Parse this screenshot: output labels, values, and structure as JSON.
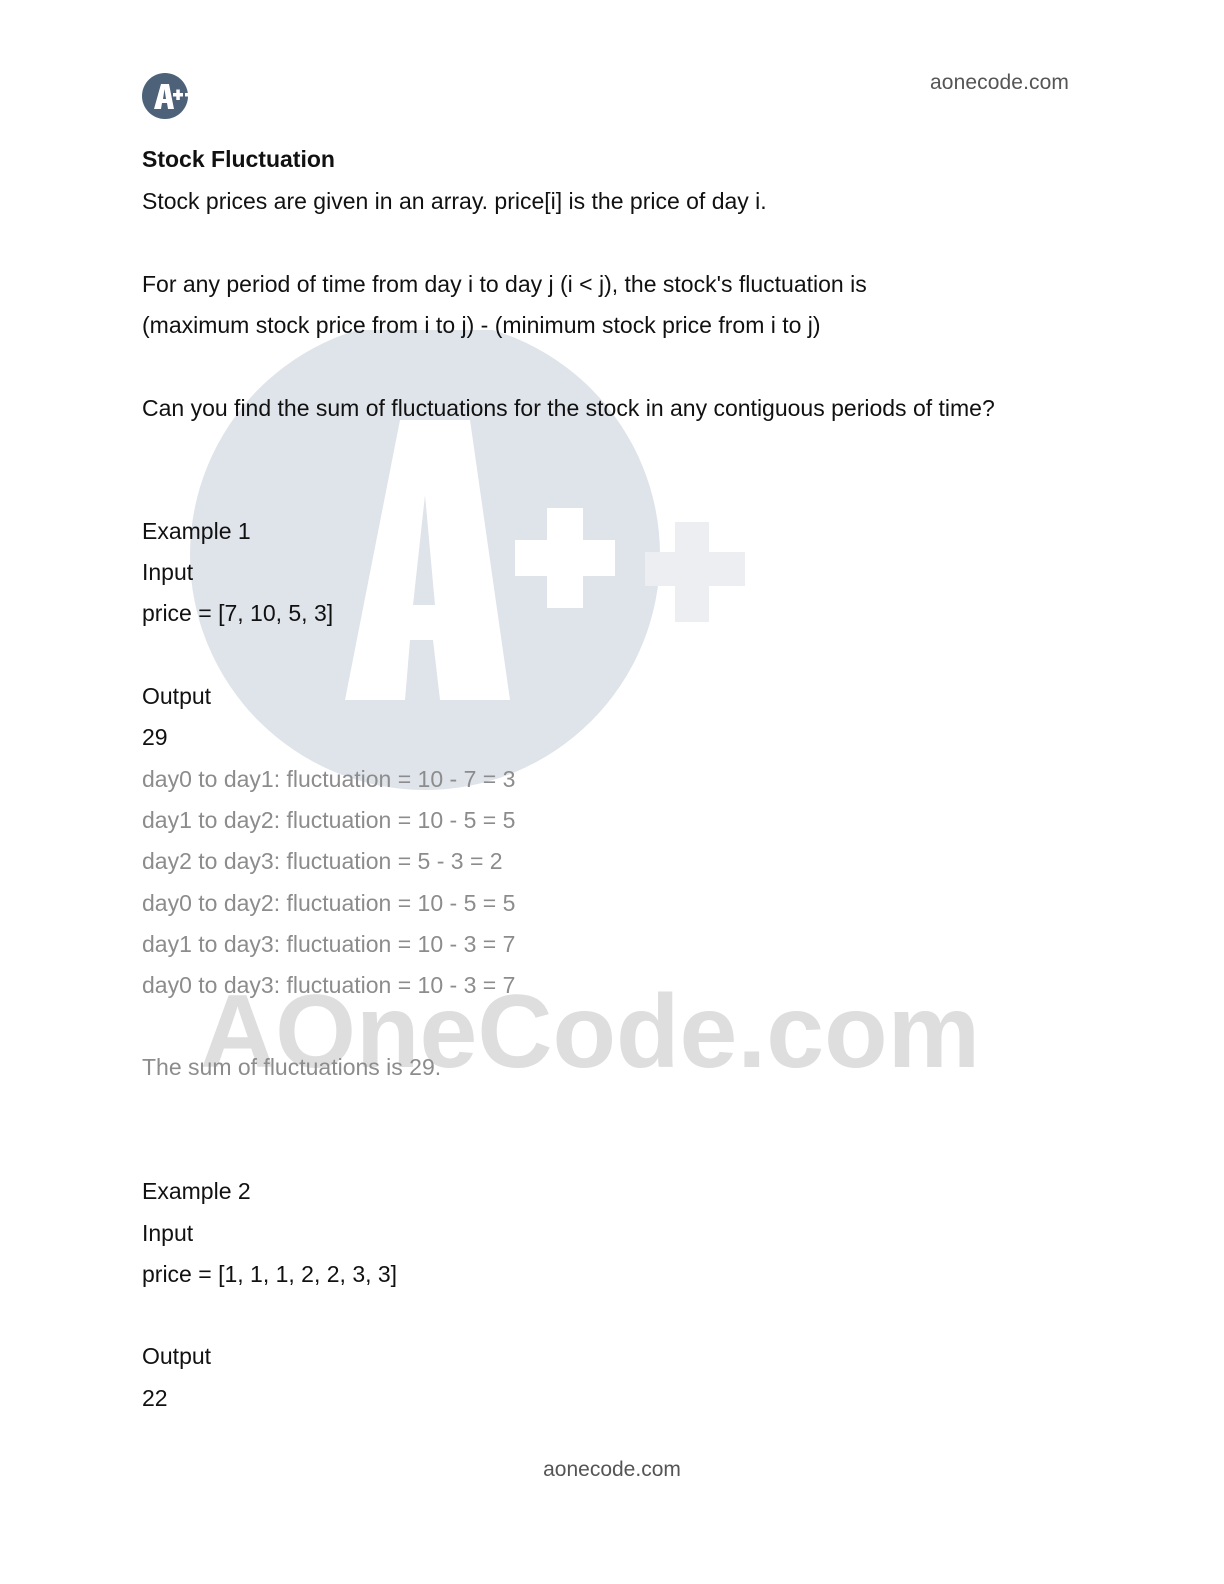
{
  "header": {
    "site": "aonecode.com"
  },
  "watermark": {
    "text": "AOneCode.com"
  },
  "problem": {
    "title": "Stock Fluctuation",
    "intro": "Stock prices are given in an array. price[i] is the price of day i.",
    "definition_line1": "For any period of time from day i to day j (i < j), the stock's fluctuation is",
    "definition_line2": "(maximum stock price from i to j) - (minimum stock price from i to j)",
    "question": "Can you find the sum of fluctuations for the stock in any contiguous periods of time?"
  },
  "example1": {
    "heading": "Example 1",
    "input_label": "Input",
    "input_value": "price = [7, 10, 5, 3]",
    "output_label": "Output",
    "output_value": "29",
    "explanation": [
      "day0 to day1: fluctuation = 10 - 7 = 3",
      "day1 to day2: fluctuation = 10 - 5 = 5",
      "day2 to day3: fluctuation = 5 - 3 = 2",
      "day0 to day2: fluctuation = 10 - 5 = 5",
      "day1 to day3: fluctuation = 10 - 3 = 7",
      "day0 to day3: fluctuation = 10 - 3 = 7"
    ],
    "summary": "The sum of fluctuations is 29."
  },
  "example2": {
    "heading": "Example 2",
    "input_label": "Input",
    "input_value": "price = [1, 1, 1, 2, 2, 3, 3]",
    "output_label": "Output",
    "output_value": "22"
  },
  "footer": {
    "site": "aonecode.com"
  },
  "colors": {
    "logo_circle": "#4d6178",
    "watermark_circle": "#dfe3ea",
    "muted_text": "#8c8c8c"
  }
}
